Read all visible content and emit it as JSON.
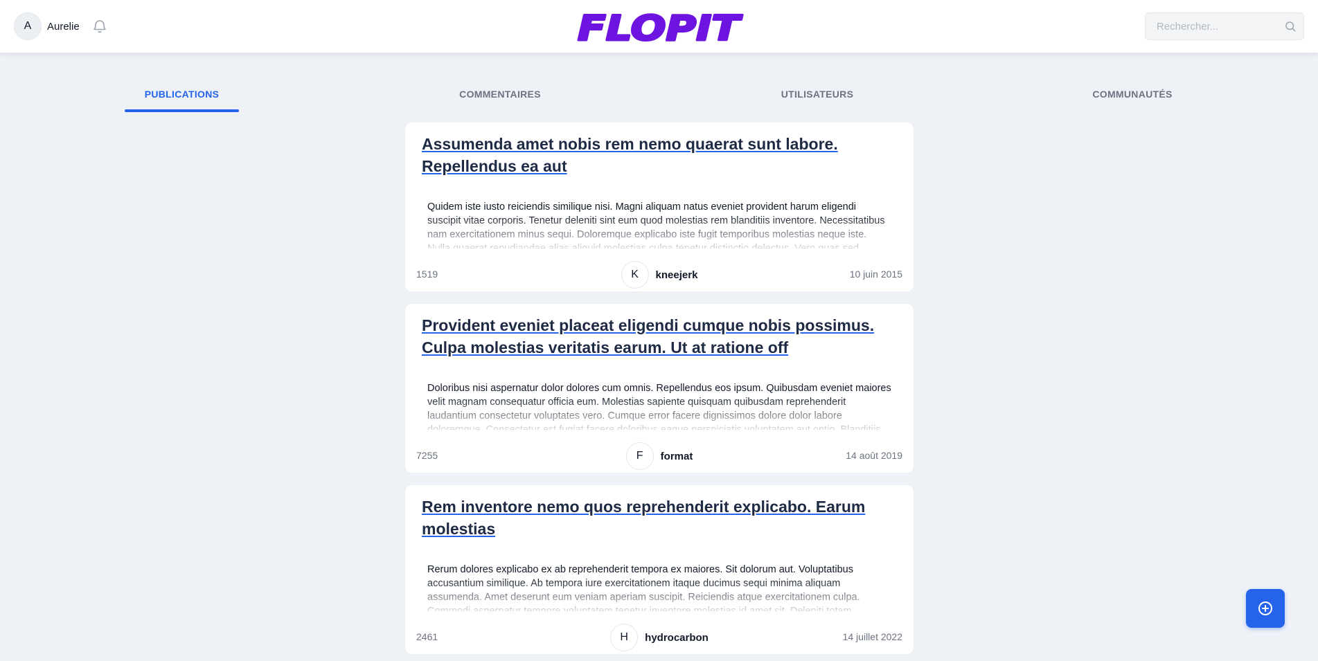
{
  "header": {
    "user": {
      "initial": "A",
      "name": "Aurelie"
    },
    "logo_text": "FLOPIT",
    "search": {
      "placeholder": "Rechercher...",
      "value": ""
    }
  },
  "tabs": [
    {
      "label": "PUBLICATIONS",
      "active": true
    },
    {
      "label": "COMMENTAIRES",
      "active": false
    },
    {
      "label": "UTILISATEURS",
      "active": false
    },
    {
      "label": "COMMUNAUTÉS",
      "active": false
    }
  ],
  "posts": [
    {
      "title": "Assumenda amet nobis rem nemo quaerat sunt labore. Repellendus ea aut",
      "body": "Quidem iste iusto reiciendis similique nisi. Magni aliquam natus eveniet provident harum eligendi suscipit vitae corporis. Tenetur deleniti sint eum quod molestias rem blanditiis inventore. Necessitatibus nam exercitationem minus sequi. Doloremque explicabo iste fugit temporibus molestias neque iste. Nulla quaerat repudiandae alias aliquid molestias culpa tenetur distinctio delectus. Vero quas sed",
      "score": "1519",
      "author_initial": "K",
      "author": "kneejerk",
      "date": "10 juin 2015"
    },
    {
      "title": "Provident eveniet placeat eligendi cumque nobis possimus. Culpa molestias veritatis earum. Ut at ratione off",
      "body": "Doloribus nisi aspernatur dolor dolores cum omnis. Repellendus eos ipsum. Quibusdam eveniet maiores velit magnam consequatur officia eum. Molestias sapiente quisquam quibusdam reprehenderit laudantium consectetur voluptates vero. Cumque error facere dignissimos dolore dolor labore doloremque. Consectetur est fugiat facere doloribus eaque perspiciatis voluptatem aut optio. Blanditiis",
      "score": "7255",
      "author_initial": "F",
      "author": "format",
      "date": "14 août 2019"
    },
    {
      "title": "Rem inventore nemo quos reprehenderit explicabo. Earum molestias",
      "body": "Rerum dolores explicabo ex ab reprehenderit tempora ex maiores. Sit dolorum aut. Voluptatibus accusantium similique. Ab tempora iure exercitationem itaque ducimus sequi minima aliquam assumenda. Amet deserunt eum veniam aperiam suscipit. Reiciendis atque exercitationem culpa. Commodi aspernatur tempore voluptatem tenetur inventore molestias id amet sit. Deleniti totam",
      "score": "2461",
      "author_initial": "H",
      "author": "hydrocarbon",
      "date": "14 juillet 2022"
    }
  ],
  "colors": {
    "accent": "#2563eb",
    "logo": "#6d14e0",
    "background": "#eef2f7"
  },
  "icons": {
    "notifications": "bell-icon",
    "search": "search-icon",
    "create_post": "plus-circle-icon"
  }
}
